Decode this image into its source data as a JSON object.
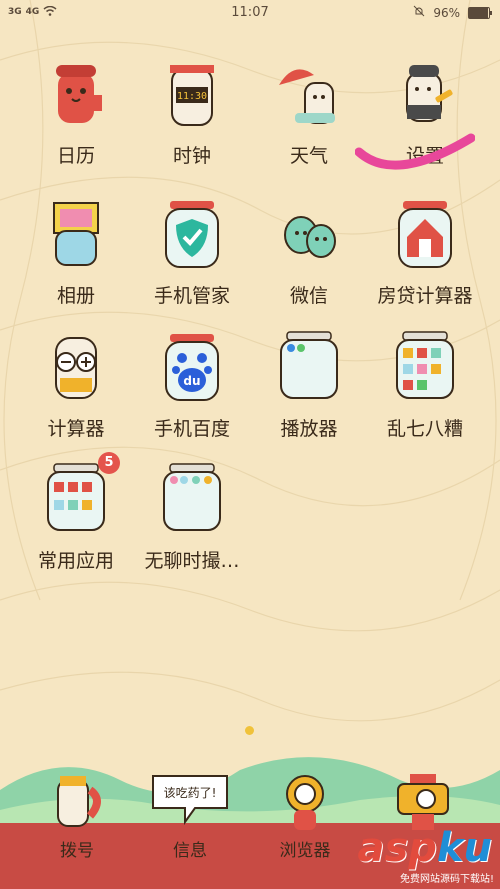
{
  "status_bar": {
    "signal_1": "3G",
    "signal_2": "4G",
    "time": "11:07",
    "battery": "96%",
    "battery_level": 0.96
  },
  "apps": [
    {
      "id": "calendar",
      "label": "日历"
    },
    {
      "id": "clock",
      "label": "时钟",
      "clock_text": "11:30"
    },
    {
      "id": "weather",
      "label": "天气"
    },
    {
      "id": "settings",
      "label": "设置"
    },
    {
      "id": "album",
      "label": "相册"
    },
    {
      "id": "phone-manager",
      "label": "手机管家"
    },
    {
      "id": "wechat",
      "label": "微信"
    },
    {
      "id": "mortgage",
      "label": "房贷计算器"
    },
    {
      "id": "calculator",
      "label": "计算器"
    },
    {
      "id": "baidu",
      "label": "手机百度",
      "icon_text": "du"
    },
    {
      "id": "player",
      "label": "播放器"
    },
    {
      "id": "misc",
      "label": "乱七八糟"
    },
    {
      "id": "common-apps",
      "label": "常用应用",
      "badge": "5"
    },
    {
      "id": "bored",
      "label": "无聊时撮…"
    }
  ],
  "dock": [
    {
      "id": "dialer",
      "label": "拨号"
    },
    {
      "id": "messages",
      "label": "信息",
      "bubble_text": "该吃药了!"
    },
    {
      "id": "browser",
      "label": "浏览器"
    },
    {
      "id": "camera",
      "label": ""
    }
  ],
  "watermark": {
    "main_a": "asp",
    "main_b": "ku",
    "sub": "免费网站源码下载站!"
  },
  "colors": {
    "background": "#f6e6c2",
    "road": "#c84b44",
    "badge": "#e4544c",
    "accent_pink": "#e8479a"
  }
}
